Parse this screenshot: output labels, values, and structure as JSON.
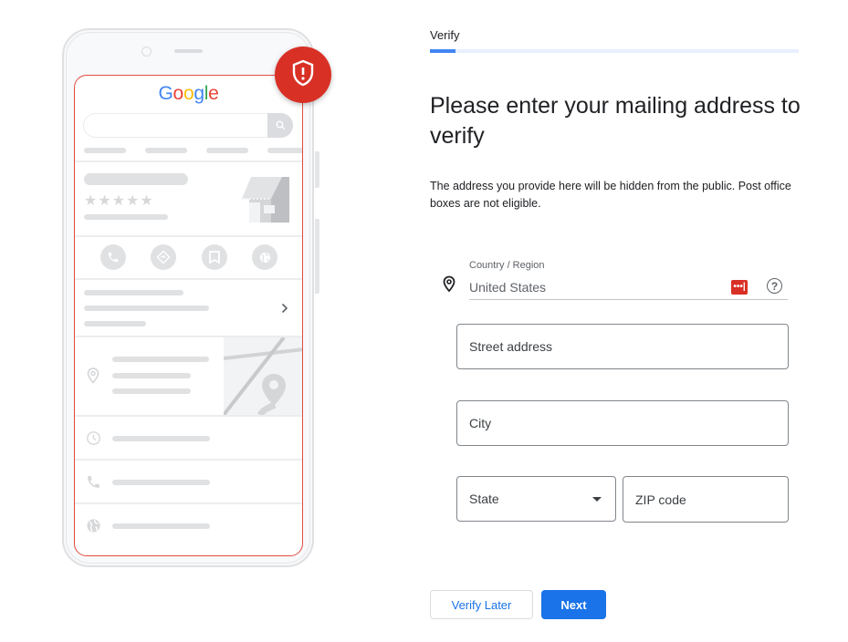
{
  "illustration": {
    "brand_logo_letters": [
      {
        "char": "G",
        "color": "#4285F4"
      },
      {
        "char": "o",
        "color": "#EA4335"
      },
      {
        "char": "o",
        "color": "#FBBC05"
      },
      {
        "char": "g",
        "color": "#4285F4"
      },
      {
        "char": "l",
        "color": "#34A853"
      },
      {
        "char": "e",
        "color": "#EA4335"
      }
    ],
    "rating_stars": "★★★★★",
    "alert_badge_color": "#D93025"
  },
  "stepper": {
    "label": "Verify",
    "progress_fraction": 0.07,
    "accent_color": "#4285F4"
  },
  "heading": "Please enter your mailing address to verify",
  "description": "The address you provide here will be hidden from the public. Post office boxes are not eligible.",
  "form": {
    "country": {
      "label": "Country / Region",
      "value": "United States"
    },
    "street": {
      "placeholder": "Street address",
      "value": ""
    },
    "city": {
      "placeholder": "City",
      "value": ""
    },
    "state": {
      "placeholder": "State",
      "value": ""
    },
    "zip": {
      "placeholder": "ZIP code",
      "value": ""
    }
  },
  "actions": {
    "secondary_label": "Verify Later",
    "primary_label": "Next",
    "primary_color": "#1A73E8"
  }
}
